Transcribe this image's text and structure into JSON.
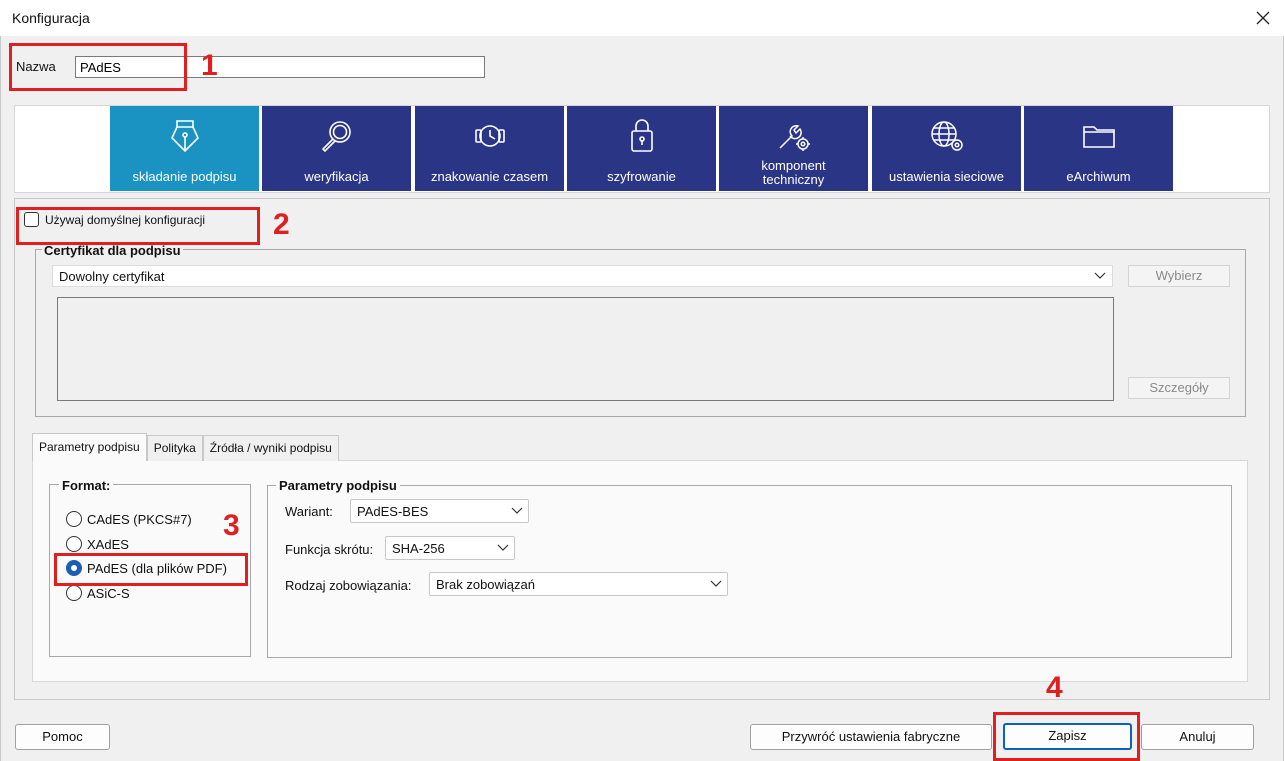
{
  "window": {
    "title": "Konfiguracja"
  },
  "name_field": {
    "label": "Nazwa",
    "value": "PAdES"
  },
  "toolbar": {
    "items": [
      {
        "label": "składanie podpisu",
        "icon": "pen-nib-icon",
        "active": true
      },
      {
        "label": "weryfikacja",
        "icon": "magnifier-icon",
        "active": false
      },
      {
        "label": "znakowanie czasem",
        "icon": "watch-icon",
        "active": false
      },
      {
        "label": "szyfrowanie",
        "icon": "padlock-icon",
        "active": false
      },
      {
        "label": "komponent techniczny",
        "icon": "wrench-gear-icon",
        "active": false
      },
      {
        "label": "ustawienia sieciowe",
        "icon": "globe-gear-icon",
        "active": false
      },
      {
        "label": "eArchiwum",
        "icon": "folder-icon",
        "active": false
      }
    ]
  },
  "use_default": {
    "label": "Używaj domyślnej konfiguracji",
    "checked": false
  },
  "certificate": {
    "group_label": "Certyfikat dla podpisu",
    "selected": "Dowolny certyfikat",
    "choose_label": "Wybierz",
    "details_label": "Szczegóły"
  },
  "tabs": [
    "Parametry podpisu",
    "Polityka",
    "Źródła / wyniki podpisu"
  ],
  "format": {
    "group_label": "Format:",
    "options": [
      "CAdES (PKCS#7)",
      "XAdES",
      "PAdES (dla plików PDF)",
      "ASiC-S"
    ],
    "selected_index": 2
  },
  "params": {
    "group_label": "Parametry podpisu",
    "variant_label": "Wariant:",
    "variant_value": "PAdES-BES",
    "hash_label": "Funkcja skrótu:",
    "hash_value": "SHA-256",
    "commitment_label": "Rodzaj zobowiązania:",
    "commitment_value": "Brak zobowiązań"
  },
  "buttons": {
    "help": "Pomoc",
    "restore": "Przywróć ustawienia fabryczne",
    "save": "Zapisz",
    "cancel": "Anuluj"
  },
  "annotations": [
    "1",
    "2",
    "3",
    "4"
  ],
  "colors": {
    "tile": "#2b3586",
    "tile_active": "#1a92c2",
    "annotation": "#e02020"
  }
}
